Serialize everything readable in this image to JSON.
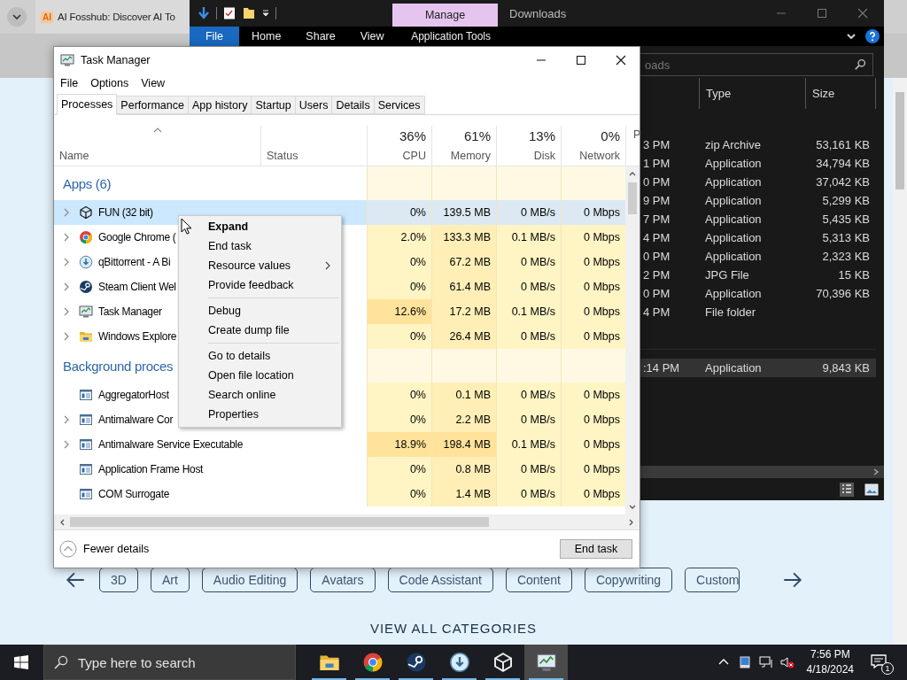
{
  "browser": {
    "favicon": "AI",
    "tab_title": "AI Fosshub: Discover AI To",
    "categories": [
      "3D",
      "Art",
      "Audio Editing",
      "Avatars",
      "Code Assistant",
      "Content",
      "Copywriting",
      "Custom"
    ],
    "section_link": "VIEW ALL CATEGORIES"
  },
  "explorer": {
    "context_group": "Manage",
    "title": "Downloads",
    "ribbon_tabs": [
      {
        "label": "File",
        "kind": "file"
      },
      {
        "label": "Home",
        "kind": "tab"
      },
      {
        "label": "Share",
        "kind": "tab"
      },
      {
        "label": "View",
        "kind": "tab"
      },
      {
        "label": "Application Tools",
        "kind": "context"
      }
    ],
    "search_placeholder": "oads",
    "columns": [
      "Type",
      "Size"
    ],
    "files": [
      {
        "modified": "3 PM",
        "type": "zip Archive",
        "size": "53,161 KB",
        "selected": false
      },
      {
        "modified": "1 PM",
        "type": "Application",
        "size": "34,794 KB",
        "selected": false
      },
      {
        "modified": "0 PM",
        "type": "Application",
        "size": "37,042 KB",
        "selected": false
      },
      {
        "modified": "9 PM",
        "type": "Application",
        "size": "5,299 KB",
        "selected": false
      },
      {
        "modified": "7 PM",
        "type": "Application",
        "size": "5,435 KB",
        "selected": false
      },
      {
        "modified": "4 PM",
        "type": "Application",
        "size": "5,313 KB",
        "selected": false
      },
      {
        "modified": "0 PM",
        "type": "Application",
        "size": "2,323 KB",
        "selected": false
      },
      {
        "modified": "2 PM",
        "type": "JPG File",
        "size": "15 KB",
        "selected": false
      },
      {
        "modified": "0 PM",
        "type": "Application",
        "size": "70,396 KB",
        "selected": false
      },
      {
        "modified": "4 PM",
        "type": "File folder",
        "selected": false
      }
    ],
    "earlier_files": [
      {
        "modified": ":14 PM",
        "type": "Application",
        "size": "9,843 KB",
        "selected": true
      }
    ]
  },
  "task_manager": {
    "title": "Task Manager",
    "menu": [
      "File",
      "Options",
      "View"
    ],
    "tabs": [
      {
        "label": "Processes",
        "selected": true
      },
      {
        "label": "Performance",
        "selected": false
      },
      {
        "label": "App history",
        "selected": false
      },
      {
        "label": "Startup",
        "selected": false
      },
      {
        "label": "Users",
        "selected": false
      },
      {
        "label": "Details",
        "selected": false
      },
      {
        "label": "Services",
        "selected": false
      }
    ],
    "columns": [
      {
        "label": "Name",
        "kind": "name"
      },
      {
        "label": "Status",
        "kind": "status"
      },
      {
        "label": "CPU",
        "usage": "36%",
        "kind": "metric"
      },
      {
        "label": "Memory",
        "usage": "61%",
        "kind": "metric"
      },
      {
        "label": "Disk",
        "usage": "13%",
        "kind": "metric"
      },
      {
        "label": "Network",
        "usage": "0%",
        "kind": "metric"
      },
      {
        "label": "P",
        "kind": "metric"
      }
    ],
    "groups": [
      {
        "title": "Apps (6)",
        "rows": [
          {
            "name": "FUN (32 bit)",
            "kind": "cube",
            "expandable": true,
            "selected": true,
            "cells": [
              {
                "text": "0%",
                "hot": false
              },
              {
                "text": "139.5 MB",
                "hot": false
              },
              {
                "text": "0 MB/s",
                "hot": false
              },
              {
                "text": "0 Mbps",
                "hot": false
              }
            ]
          },
          {
            "name": "Google Chrome (",
            "kind": "browser",
            "expandable": true,
            "selected": false,
            "cells": [
              {
                "text": "2.0%",
                "hot": false
              },
              {
                "text": "133.3 MB",
                "hot": false
              },
              {
                "text": "0.1 MB/s",
                "hot": false
              },
              {
                "text": "0 Mbps",
                "hot": false
              }
            ]
          },
          {
            "name": "qBittorrent - A Bi",
            "kind": "download",
            "expandable": true,
            "selected": false,
            "cells": [
              {
                "text": "0%",
                "hot": false
              },
              {
                "text": "67.2 MB",
                "hot": false
              },
              {
                "text": "0 MB/s",
                "hot": false
              },
              {
                "text": "0 Mbps",
                "hot": false
              }
            ]
          },
          {
            "name": "Steam Client Wel",
            "kind": "steam",
            "expandable": true,
            "selected": false,
            "cells": [
              {
                "text": "0%",
                "hot": false
              },
              {
                "text": "61.4 MB",
                "hot": false
              },
              {
                "text": "0 MB/s",
                "hot": false
              },
              {
                "text": "0 Mbps",
                "hot": false
              }
            ]
          },
          {
            "name": "Task Manager",
            "kind": "monitor",
            "expandable": true,
            "selected": false,
            "cells": [
              {
                "text": "12.6%",
                "hot": true
              },
              {
                "text": "17.2 MB",
                "hot": false
              },
              {
                "text": "0.1 MB/s",
                "hot": false
              },
              {
                "text": "0 Mbps",
                "hot": false
              }
            ]
          },
          {
            "name": "Windows Explore",
            "kind": "folder",
            "expandable": true,
            "selected": false,
            "cells": [
              {
                "text": "0%",
                "hot": false
              },
              {
                "text": "26.4 MB",
                "hot": false
              },
              {
                "text": "0 MB/s",
                "hot": false
              },
              {
                "text": "0 Mbps",
                "hot": false
              }
            ]
          }
        ]
      },
      {
        "title": "Background proces",
        "rows": [
          {
            "name": "AggregatorHost",
            "kind": "window",
            "expandable": false,
            "selected": false,
            "cells": [
              {
                "text": "0%",
                "hot": false
              },
              {
                "text": "0.1 MB",
                "hot": false
              },
              {
                "text": "0 MB/s",
                "hot": false
              },
              {
                "text": "0 Mbps",
                "hot": false
              }
            ]
          },
          {
            "name": "Antimalware Cor",
            "kind": "window",
            "expandable": true,
            "selected": false,
            "cells": [
              {
                "text": "0%",
                "hot": false
              },
              {
                "text": "2.2 MB",
                "hot": false
              },
              {
                "text": "0 MB/s",
                "hot": false
              },
              {
                "text": "0 Mbps",
                "hot": false
              }
            ]
          },
          {
            "name": "Antimalware Service Executable",
            "kind": "window",
            "expandable": true,
            "selected": false,
            "cells": [
              {
                "text": "18.9%",
                "hot": true
              },
              {
                "text": "198.4 MB",
                "hot": true
              },
              {
                "text": "0.1 MB/s",
                "hot": false
              },
              {
                "text": "0 Mbps",
                "hot": false
              }
            ]
          },
          {
            "name": "Application Frame Host",
            "kind": "window",
            "expandable": false,
            "selected": false,
            "cells": [
              {
                "text": "0%",
                "hot": false
              },
              {
                "text": "0.8 MB",
                "hot": false
              },
              {
                "text": "0 MB/s",
                "hot": false
              },
              {
                "text": "0 Mbps",
                "hot": false
              }
            ]
          },
          {
            "name": "COM Surrogate",
            "kind": "window",
            "expandable": false,
            "selected": false,
            "cells": [
              {
                "text": "0%",
                "hot": false
              },
              {
                "text": "1.4 MB",
                "hot": false
              },
              {
                "text": "0 MB/s",
                "hot": false
              },
              {
                "text": "0 Mbps",
                "hot": false
              }
            ]
          }
        ]
      }
    ],
    "context_menu": [
      {
        "kind": "item",
        "label": "Expand",
        "default": true,
        "submenu": false
      },
      {
        "kind": "item",
        "label": "End task",
        "default": false,
        "submenu": false
      },
      {
        "kind": "item",
        "label": "Resource values",
        "default": false,
        "submenu": true
      },
      {
        "kind": "item",
        "label": "Provide feedback",
        "default": false,
        "submenu": false
      },
      {
        "kind": "separator"
      },
      {
        "kind": "item",
        "label": "Debug",
        "default": false,
        "submenu": false
      },
      {
        "kind": "item",
        "label": "Create dump file",
        "default": false,
        "submenu": false
      },
      {
        "kind": "separator"
      },
      {
        "kind": "item",
        "label": "Go to details",
        "default": false,
        "submenu": false
      },
      {
        "kind": "item",
        "label": "Open file location",
        "default": false,
        "submenu": false
      },
      {
        "kind": "item",
        "label": "Search online",
        "default": false,
        "submenu": false
      },
      {
        "kind": "item",
        "label": "Properties",
        "default": false,
        "submenu": false
      }
    ],
    "fewer_details": "Fewer details",
    "end_task": "End task"
  },
  "taskbar": {
    "search_placeholder": "Type here to search",
    "apps": [
      {
        "kind": "folder",
        "running": true,
        "active": false
      },
      {
        "kind": "browser",
        "running": true,
        "active": false
      },
      {
        "kind": "steam",
        "running": true,
        "active": false
      },
      {
        "kind": "download",
        "running": true,
        "active": false
      },
      {
        "kind": "cube",
        "running": true,
        "active": false
      },
      {
        "kind": "monitor",
        "running": true,
        "active": true
      }
    ],
    "time": "7:56 PM",
    "date": "4/18/2024",
    "notification_count": "1"
  }
}
